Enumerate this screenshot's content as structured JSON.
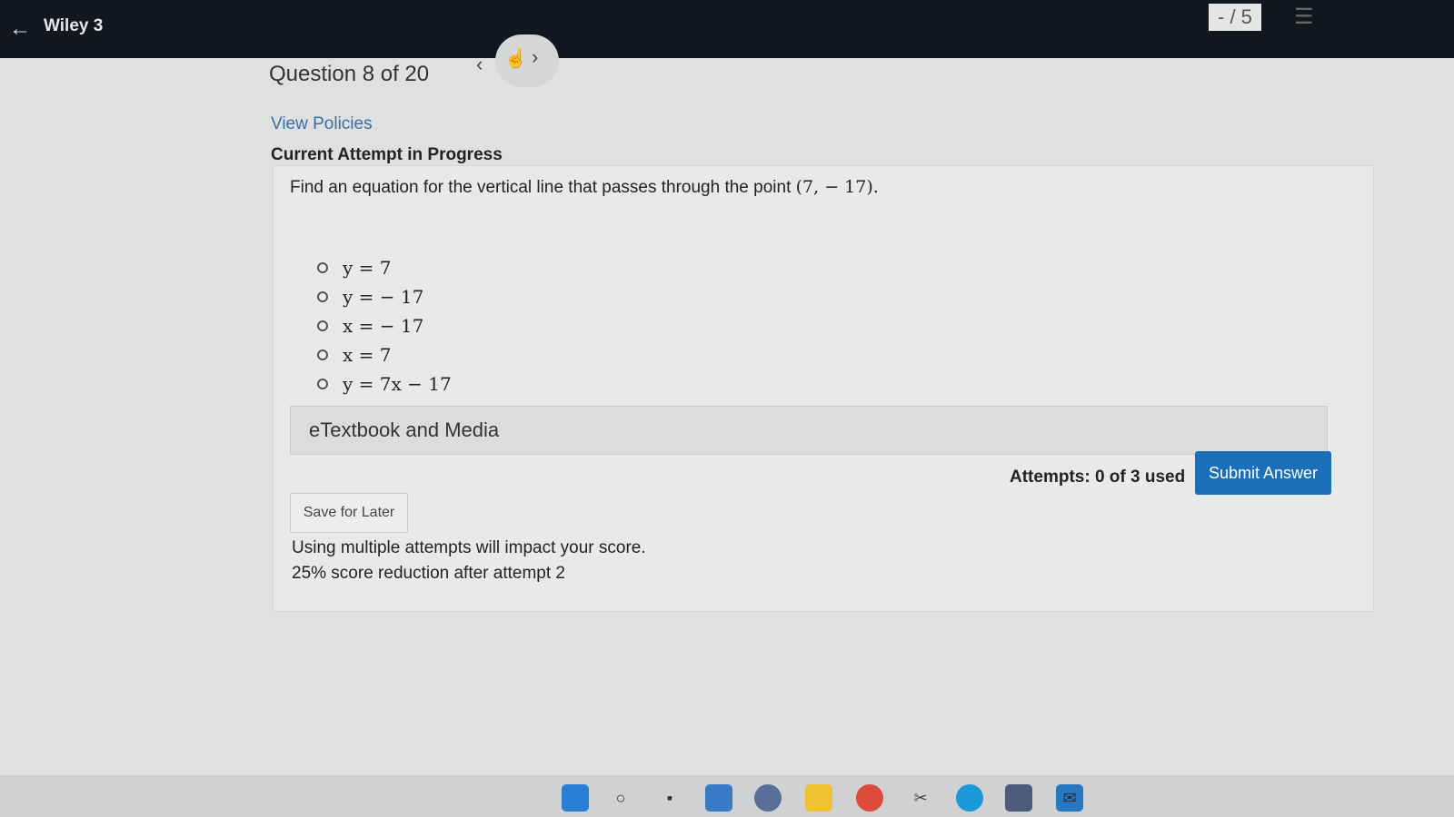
{
  "header": {
    "course_title": "Wiley 3",
    "score": "- / 5",
    "icons": {
      "back": "arrow-left-icon",
      "menu": "list-icon"
    }
  },
  "navigation": {
    "question_position": "Question 8 of 20",
    "icons": {
      "prev": "chevron-left-icon",
      "next": "chevron-right-icon",
      "cursor": "hand-pointer-icon"
    }
  },
  "links": {
    "view_policies": "View Policies"
  },
  "status": {
    "attempt_in_progress": "Current Attempt in Progress"
  },
  "question": {
    "text": "Find an equation for the vertical line that passes through the point",
    "point": "(7, − 17).",
    "choices": [
      {
        "label": "y = 7"
      },
      {
        "label": "y = − 17"
      },
      {
        "label": "x = − 17"
      },
      {
        "label": "x = 7"
      },
      {
        "label": "y = 7x − 17"
      }
    ]
  },
  "etextbook": {
    "label": "eTextbook and Media"
  },
  "actions": {
    "attempts": "Attempts: 0 of 3 used",
    "submit_label": "Submit Answer",
    "save_label": "Save for Later"
  },
  "notes": {
    "multiple_attempts": "Using multiple attempts will impact your score.",
    "reduction": "25% score reduction after attempt 2"
  },
  "colors": {
    "primary_button": "#1b6fb8",
    "link": "#3a6ea5",
    "topbar": "#11161f"
  },
  "taskbar": {
    "icons": [
      "windows-start-icon",
      "search-icon",
      "task-view-icon",
      "widgets-icon",
      "app-icon",
      "file-explorer-icon",
      "chrome-icon",
      "snipping-tool-icon",
      "edge-icon",
      "store-icon",
      "mail-icon"
    ]
  }
}
